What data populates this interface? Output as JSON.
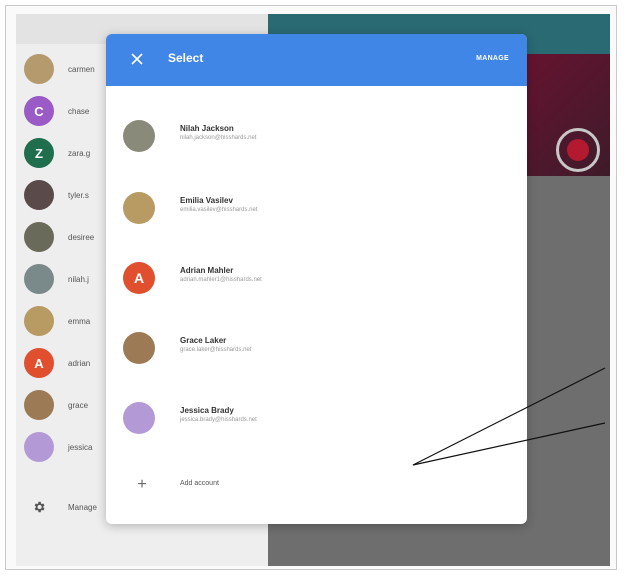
{
  "dialog": {
    "title": "Select",
    "manage_label": "MANAGE",
    "close_icon": "close-icon",
    "header_color": "#3f86e6",
    "accounts": [
      {
        "name": "Nilah Jackson",
        "email": "nilah.jackson@hisshards.net",
        "avatar_color": "#8a8a7a"
      },
      {
        "name": "Emilia Vasilev",
        "email": "emilia.vasilev@hisshards.net",
        "avatar_color": "#b89a63"
      },
      {
        "name": "Adrian Mahler",
        "email": "adrian.mahler1@hisshards.net",
        "avatar_color": "#e0502f",
        "initial": "A"
      },
      {
        "name": "Grace Laker",
        "email": "grace.laker@hisshards.net",
        "avatar_color": "#9c7a55"
      },
      {
        "name": "Jessica Brady",
        "email": "jessica.brady@hisshards.net",
        "avatar_color": "#b39ad6"
      }
    ],
    "add_account_label": "Add account",
    "add_icon": "plus-icon"
  },
  "sidebar": {
    "items": [
      {
        "label": "carmen",
        "avatar_color": "#b59a6e",
        "initial": ""
      },
      {
        "label": "chase",
        "avatar_color": "#9a5bc6",
        "initial": "C"
      },
      {
        "label": "zara.g",
        "avatar_color": "#1f6e4e",
        "initial": "Z"
      },
      {
        "label": "tyler.s",
        "avatar_color": "#5a4a4a",
        "initial": ""
      },
      {
        "label": "desiree",
        "avatar_color": "#6a6a5a",
        "initial": ""
      },
      {
        "label": "nilah.j",
        "avatar_color": "#7a8a8a",
        "initial": ""
      },
      {
        "label": "emma",
        "avatar_color": "#b89a63",
        "initial": ""
      },
      {
        "label": "adrian",
        "avatar_color": "#e0502f",
        "initial": "A"
      },
      {
        "label": "grace",
        "avatar_color": "#9c7a55",
        "initial": ""
      },
      {
        "label": "jessica",
        "avatar_color": "#b39ad6",
        "initial": ""
      }
    ],
    "manage_label": "Manage",
    "gear_icon": "gear-icon"
  }
}
